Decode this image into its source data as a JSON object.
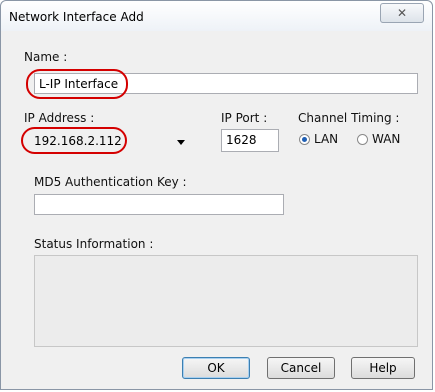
{
  "dialog": {
    "title": "Network Interface Add",
    "close_glyph": "✕"
  },
  "name": {
    "label": "Name :",
    "value": "L-IP Interface"
  },
  "ip_address": {
    "label": "IP Address :",
    "value": "192.168.2.112"
  },
  "ip_port": {
    "label": "IP Port :",
    "value": "1628"
  },
  "channel_timing": {
    "label": "Channel Timing :",
    "options": [
      "LAN",
      "WAN"
    ],
    "selected": "LAN"
  },
  "md5": {
    "label": "MD5 Authentication Key :",
    "value": ""
  },
  "status": {
    "label": "Status Information :",
    "value": ""
  },
  "buttons": {
    "ok": "OK",
    "cancel": "Cancel",
    "help": "Help"
  },
  "annotation_color": "#d40000",
  "accent_color": "#1f5fb4"
}
